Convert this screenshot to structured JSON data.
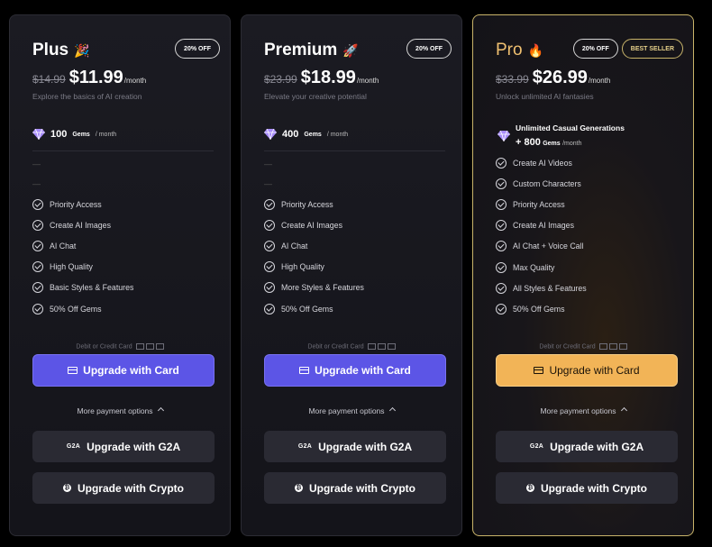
{
  "plans": [
    {
      "name": "Plus",
      "emoji": "🎉",
      "badges": [
        "20% OFF"
      ],
      "old_price": "$14.99",
      "price": "$11.99",
      "per": "/month",
      "subtitle": "Explore the basics of AI creation",
      "gems_amount": "100",
      "gems_unit": "Gems",
      "gems_period": "/ month",
      "features": [
        "Priority Access",
        "Create AI Images",
        "AI Chat",
        "High Quality",
        "Basic Styles & Features",
        "50% Off Gems"
      ],
      "debit_label": "Debit or Credit Card",
      "card_button": "Upgrade with Card",
      "more_options": "More payment options",
      "g2a_logo": "G2A",
      "g2a_button": "Upgrade with G2A",
      "crypto_button": "Upgrade with Crypto"
    },
    {
      "name": "Premium",
      "emoji": "🚀",
      "badges": [
        "20% OFF"
      ],
      "old_price": "$23.99",
      "price": "$18.99",
      "per": "/month",
      "subtitle": "Elevate your creative potential",
      "gems_amount": "400",
      "gems_unit": "Gems",
      "gems_period": "/ month",
      "features": [
        "Priority Access",
        "Create AI Images",
        "AI Chat",
        "High Quality",
        "More Styles & Features",
        "50% Off Gems"
      ],
      "debit_label": "Debit or Credit Card",
      "card_button": "Upgrade with Card",
      "more_options": "More payment options",
      "g2a_logo": "G2A",
      "g2a_button": "Upgrade with G2A",
      "crypto_button": "Upgrade with Crypto"
    },
    {
      "name": "Pro",
      "emoji": "🔥",
      "badges": [
        "20% OFF",
        "BEST SELLER"
      ],
      "old_price": "$33.99",
      "price": "$26.99",
      "per": "/month",
      "subtitle": "Unlock unlimited AI fantasies",
      "gems_line1": "Unlimited Casual Generations",
      "gems_amount": "+ 800",
      "gems_unit": "Gems",
      "gems_period": "/month",
      "features": [
        "Create AI Videos",
        "Custom Characters",
        "Priority Access",
        "Create AI Images",
        "AI Chat + Voice Call",
        "Max Quality",
        "All Styles & Features",
        "50% Off Gems"
      ],
      "debit_label": "Debit or Credit Card",
      "card_button": "Upgrade with Card",
      "more_options": "More payment options",
      "g2a_logo": "G2A",
      "g2a_button": "Upgrade with G2A",
      "crypto_button": "Upgrade with Crypto"
    }
  ],
  "colors": {
    "accent_purple": "#5c55e6",
    "accent_gold": "#f2b457",
    "gem_purple": "#a78bfa"
  }
}
